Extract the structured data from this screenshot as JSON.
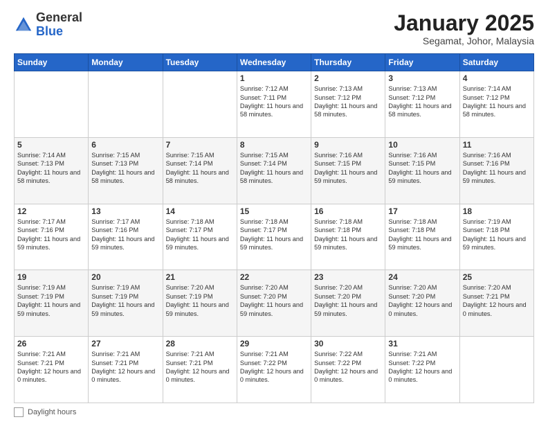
{
  "header": {
    "logo_general": "General",
    "logo_blue": "Blue",
    "month_title": "January 2025",
    "location": "Segamat, Johor, Malaysia"
  },
  "days_of_week": [
    "Sunday",
    "Monday",
    "Tuesday",
    "Wednesday",
    "Thursday",
    "Friday",
    "Saturday"
  ],
  "weeks": [
    [
      {
        "day": "",
        "info": ""
      },
      {
        "day": "",
        "info": ""
      },
      {
        "day": "",
        "info": ""
      },
      {
        "day": "1",
        "info": "Sunrise: 7:12 AM\nSunset: 7:11 PM\nDaylight: 11 hours\nand 58 minutes."
      },
      {
        "day": "2",
        "info": "Sunrise: 7:13 AM\nSunset: 7:12 PM\nDaylight: 11 hours\nand 58 minutes."
      },
      {
        "day": "3",
        "info": "Sunrise: 7:13 AM\nSunset: 7:12 PM\nDaylight: 11 hours\nand 58 minutes."
      },
      {
        "day": "4",
        "info": "Sunrise: 7:14 AM\nSunset: 7:12 PM\nDaylight: 11 hours\nand 58 minutes."
      }
    ],
    [
      {
        "day": "5",
        "info": "Sunrise: 7:14 AM\nSunset: 7:13 PM\nDaylight: 11 hours\nand 58 minutes."
      },
      {
        "day": "6",
        "info": "Sunrise: 7:15 AM\nSunset: 7:13 PM\nDaylight: 11 hours\nand 58 minutes."
      },
      {
        "day": "7",
        "info": "Sunrise: 7:15 AM\nSunset: 7:14 PM\nDaylight: 11 hours\nand 58 minutes."
      },
      {
        "day": "8",
        "info": "Sunrise: 7:15 AM\nSunset: 7:14 PM\nDaylight: 11 hours\nand 58 minutes."
      },
      {
        "day": "9",
        "info": "Sunrise: 7:16 AM\nSunset: 7:15 PM\nDaylight: 11 hours\nand 59 minutes."
      },
      {
        "day": "10",
        "info": "Sunrise: 7:16 AM\nSunset: 7:15 PM\nDaylight: 11 hours\nand 59 minutes."
      },
      {
        "day": "11",
        "info": "Sunrise: 7:16 AM\nSunset: 7:16 PM\nDaylight: 11 hours\nand 59 minutes."
      }
    ],
    [
      {
        "day": "12",
        "info": "Sunrise: 7:17 AM\nSunset: 7:16 PM\nDaylight: 11 hours\nand 59 minutes."
      },
      {
        "day": "13",
        "info": "Sunrise: 7:17 AM\nSunset: 7:16 PM\nDaylight: 11 hours\nand 59 minutes."
      },
      {
        "day": "14",
        "info": "Sunrise: 7:18 AM\nSunset: 7:17 PM\nDaylight: 11 hours\nand 59 minutes."
      },
      {
        "day": "15",
        "info": "Sunrise: 7:18 AM\nSunset: 7:17 PM\nDaylight: 11 hours\nand 59 minutes."
      },
      {
        "day": "16",
        "info": "Sunrise: 7:18 AM\nSunset: 7:18 PM\nDaylight: 11 hours\nand 59 minutes."
      },
      {
        "day": "17",
        "info": "Sunrise: 7:18 AM\nSunset: 7:18 PM\nDaylight: 11 hours\nand 59 minutes."
      },
      {
        "day": "18",
        "info": "Sunrise: 7:19 AM\nSunset: 7:18 PM\nDaylight: 11 hours\nand 59 minutes."
      }
    ],
    [
      {
        "day": "19",
        "info": "Sunrise: 7:19 AM\nSunset: 7:19 PM\nDaylight: 11 hours\nand 59 minutes."
      },
      {
        "day": "20",
        "info": "Sunrise: 7:19 AM\nSunset: 7:19 PM\nDaylight: 11 hours\nand 59 minutes."
      },
      {
        "day": "21",
        "info": "Sunrise: 7:20 AM\nSunset: 7:19 PM\nDaylight: 11 hours\nand 59 minutes."
      },
      {
        "day": "22",
        "info": "Sunrise: 7:20 AM\nSunset: 7:20 PM\nDaylight: 11 hours\nand 59 minutes."
      },
      {
        "day": "23",
        "info": "Sunrise: 7:20 AM\nSunset: 7:20 PM\nDaylight: 11 hours\nand 59 minutes."
      },
      {
        "day": "24",
        "info": "Sunrise: 7:20 AM\nSunset: 7:20 PM\nDaylight: 12 hours\nand 0 minutes."
      },
      {
        "day": "25",
        "info": "Sunrise: 7:20 AM\nSunset: 7:21 PM\nDaylight: 12 hours\nand 0 minutes."
      }
    ],
    [
      {
        "day": "26",
        "info": "Sunrise: 7:21 AM\nSunset: 7:21 PM\nDaylight: 12 hours\nand 0 minutes."
      },
      {
        "day": "27",
        "info": "Sunrise: 7:21 AM\nSunset: 7:21 PM\nDaylight: 12 hours\nand 0 minutes."
      },
      {
        "day": "28",
        "info": "Sunrise: 7:21 AM\nSunset: 7:21 PM\nDaylight: 12 hours\nand 0 minutes."
      },
      {
        "day": "29",
        "info": "Sunrise: 7:21 AM\nSunset: 7:22 PM\nDaylight: 12 hours\nand 0 minutes."
      },
      {
        "day": "30",
        "info": "Sunrise: 7:22 AM\nSunset: 7:22 PM\nDaylight: 12 hours\nand 0 minutes."
      },
      {
        "day": "31",
        "info": "Sunrise: 7:21 AM\nSunset: 7:22 PM\nDaylight: 12 hours\nand 0 minutes."
      },
      {
        "day": "",
        "info": ""
      }
    ]
  ],
  "footer": {
    "daylight_label": "Daylight hours"
  }
}
